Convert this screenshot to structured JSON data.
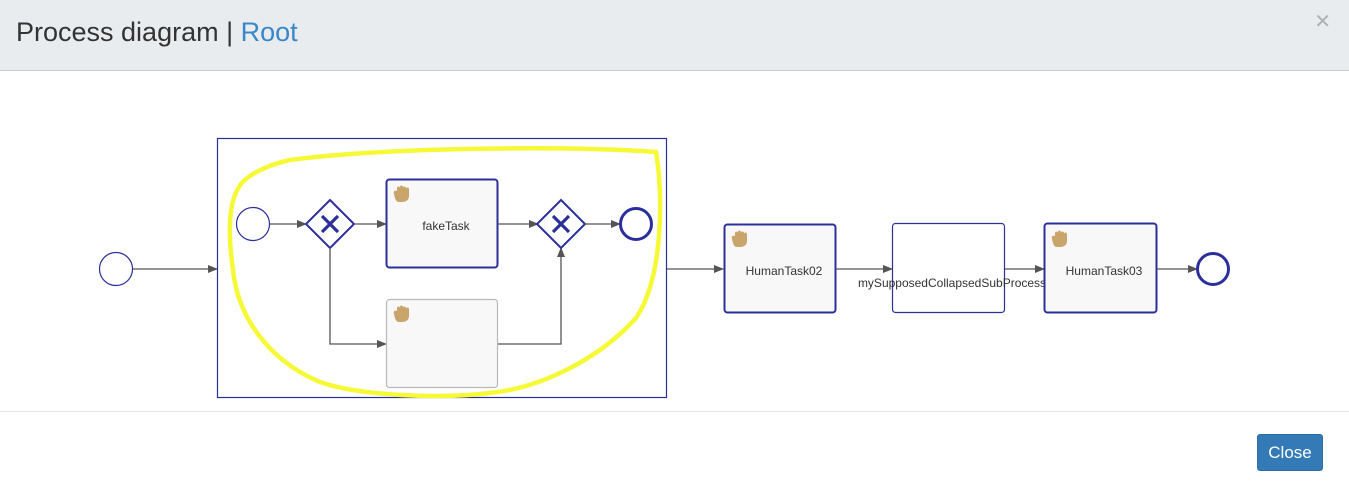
{
  "modal": {
    "title": "Process diagram",
    "separator": "|",
    "title_link": "Root",
    "close_icon": "close-icon",
    "close_button_label": "Close"
  },
  "diagram": {
    "tasks": {
      "fake_task": "fakeTask",
      "human_task_02": "HumanTask02",
      "collapsed_subprocess": "mySupposedCollapsedSubProcess",
      "human_task_03": "HumanTask03"
    },
    "icons": {
      "user_task": "hand-icon",
      "gateway": "exclusive-gateway-icon"
    },
    "colors": {
      "bpmn_stroke": "#2b2f9a",
      "highlight": "#f6f935",
      "hand": "#c9a56b",
      "task_fill": "#f8f8f8",
      "inactive_stroke": "#b8b8b8",
      "flow": "#555555"
    }
  }
}
